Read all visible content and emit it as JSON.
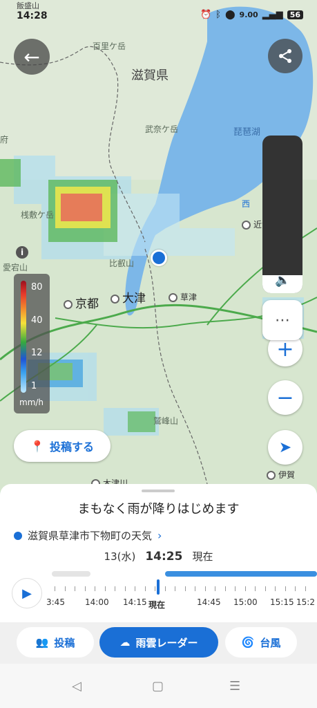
{
  "status_bar": {
    "place": "飯盛山",
    "time": "14:28",
    "speed": "9.00",
    "battery": "56"
  },
  "map": {
    "labels": {
      "hyakurigatake": "百里ケ岳",
      "shiga": "滋賀県",
      "bunagatake": "武奈ケ岳",
      "biwako": "琵琶湖",
      "nishi": "西",
      "omihachiman": "近江八幡",
      "kusatsu": "草津",
      "otsu": "大津",
      "kyoto": "京都",
      "atagoyama": "愛宕山",
      "sanzukagatake": "桟敷ケ岳",
      "hieizan": "比叡山",
      "washimineyama": "鷲峰山",
      "iga": "伊賀",
      "kizugawa": "木津川",
      "fu": "府"
    },
    "legend": {
      "values": [
        "80",
        "40",
        "12",
        "1"
      ],
      "unit": "mm/h"
    },
    "post_button": "投稿する"
  },
  "sheet": {
    "headline": "まもなく雨が降りはじめます",
    "location": "滋賀県草津市下物町の天気",
    "date": "13(水)",
    "time": "14:25",
    "now": "現在",
    "timeline_labels": [
      "3:45",
      "14:00",
      "14:15",
      "現在",
      "14:45",
      "15:00",
      "15:15",
      "15:2"
    ]
  },
  "tabs": [
    {
      "label": "投稿",
      "icon": "people-icon"
    },
    {
      "label": "雨雲レーダー",
      "icon": "rain-cloud-icon"
    },
    {
      "label": "台風",
      "icon": "typhoon-icon"
    }
  ],
  "colors": {
    "accent": "#1a6fd6",
    "lake": "#7cb7e8"
  }
}
